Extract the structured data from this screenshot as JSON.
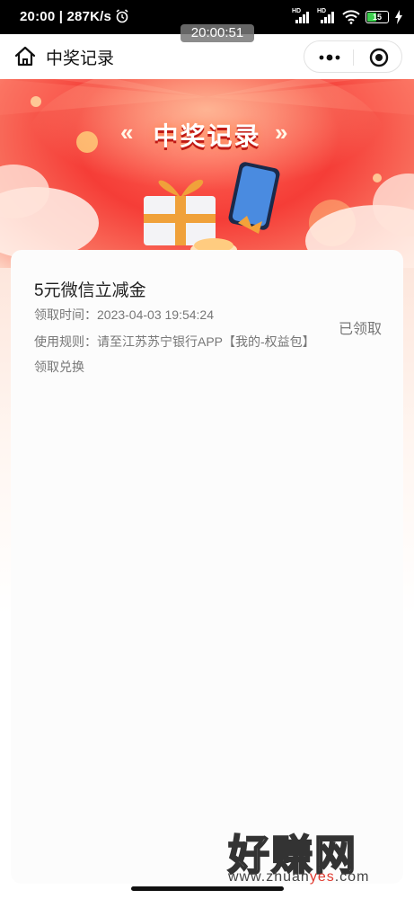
{
  "status_bar": {
    "time": "20:00",
    "speed": "287K/s",
    "battery": "15",
    "alarm_icon": "alarm-clock-icon",
    "network_label": "HD"
  },
  "overlay_time": "20:00:51",
  "navbar": {
    "title": "中奖记录",
    "home_icon": "home-icon",
    "more_icon": "more-dots-icon",
    "close_icon": "target-close-icon"
  },
  "banner": {
    "title": "中奖记录",
    "left_chevron": "«",
    "right_chevron": "»"
  },
  "records": [
    {
      "name": "5元微信立减金",
      "time_label": "领取时间：",
      "time": "2023-04-03 19:54:24",
      "rule_label": "使用规则：",
      "rule": "请至江苏苏宁银行APP【我的-权益包】领取兑换",
      "status": "已领取"
    }
  ],
  "watermark": {
    "brand": "好赚网",
    "url_prefix": "www.zhuan",
    "url_highlight": "yes",
    "url_suffix": ".com"
  },
  "colors": {
    "banner_red": "#f53d37",
    "page_peach": "#fde6dc",
    "text_secondary": "#777777"
  }
}
